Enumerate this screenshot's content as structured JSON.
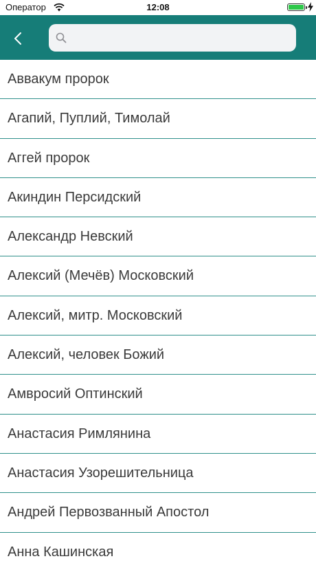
{
  "status_bar": {
    "carrier": "Оператор",
    "time": "12:08",
    "battery_level": 1.0,
    "charging": true,
    "battery_color": "#2ec84a"
  },
  "nav_bar": {
    "background_color": "#167d78",
    "back_icon": "chevron-left-icon",
    "search": {
      "icon": "search-icon",
      "placeholder": "",
      "value": ""
    }
  },
  "list": {
    "separator_color": "#2e8f8a",
    "items": [
      {
        "label": "Аввакум пророк"
      },
      {
        "label": "Агапий, Пуплий, Тимолай"
      },
      {
        "label": "Аггей пророк"
      },
      {
        "label": "Акиндин Персидский"
      },
      {
        "label": "Александр Невский"
      },
      {
        "label": "Алексий (Мечёв) Московский"
      },
      {
        "label": "Алексий, митр. Московский"
      },
      {
        "label": "Алексий, человек Божий"
      },
      {
        "label": "Амвросий Оптинский"
      },
      {
        "label": "Анастасия Римлянина"
      },
      {
        "label": "Анастасия Узорешительница"
      },
      {
        "label": "Андрей Первозванный Апостол"
      },
      {
        "label": "Анна Кашинская"
      }
    ]
  }
}
